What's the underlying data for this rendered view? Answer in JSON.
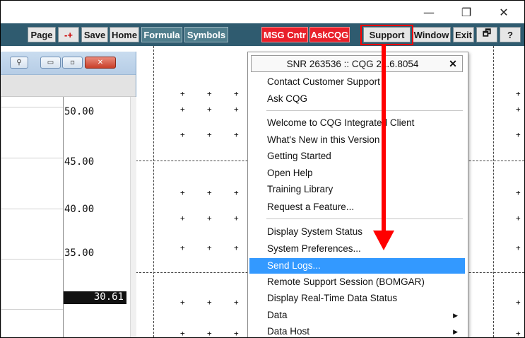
{
  "window_controls": {
    "minimize": "—",
    "restore": "❐",
    "close": "✕"
  },
  "toolbar": {
    "buttons": [
      {
        "label": "Page",
        "style": "light"
      },
      {
        "label": "-+",
        "style": "light"
      },
      {
        "label": "Save",
        "style": "light"
      },
      {
        "label": "Home",
        "style": "light"
      },
      {
        "label": "Formula",
        "style": "dark"
      },
      {
        "label": "Symbols",
        "style": "dark"
      },
      {
        "label": "MSG Cntr",
        "style": "red"
      },
      {
        "label": "AskCQG",
        "style": "red"
      },
      {
        "label": "Support",
        "style": "light"
      },
      {
        "label": "Window",
        "style": "light"
      },
      {
        "label": "Exit",
        "style": "light"
      },
      {
        "label": "🗗",
        "style": "light"
      },
      {
        "label": "?",
        "style": "light"
      }
    ]
  },
  "subwindow": {
    "prices": [
      "50.00",
      "45.00",
      "40.00",
      "35.00"
    ],
    "last_price": "30.61"
  },
  "support_menu": {
    "header": "SNR 263536 :: CQG 21.6.8054",
    "header_close": "✕",
    "groups": [
      [
        "Contact Customer Support",
        "Ask CQG"
      ],
      [
        "Welcome to CQG Integrated Client",
        "What's New in this Version",
        "Getting Started",
        "Open Help",
        "Training Library",
        "Request a Feature..."
      ],
      [
        "Display System Status",
        "System Preferences...",
        "Send Logs...",
        "Remote Support Session (BOMGAR)",
        "Display Real-Time Data Status",
        "Data",
        "Data Host"
      ]
    ],
    "selected_item": "Send Logs...",
    "submenu_items": [
      "Data",
      "Data Host"
    ],
    "submenu_arrow": "▶"
  },
  "colors": {
    "toolbar_bg": "#2f5b6f",
    "highlight": "#3399ff",
    "annotation_red": "#ff0000"
  }
}
